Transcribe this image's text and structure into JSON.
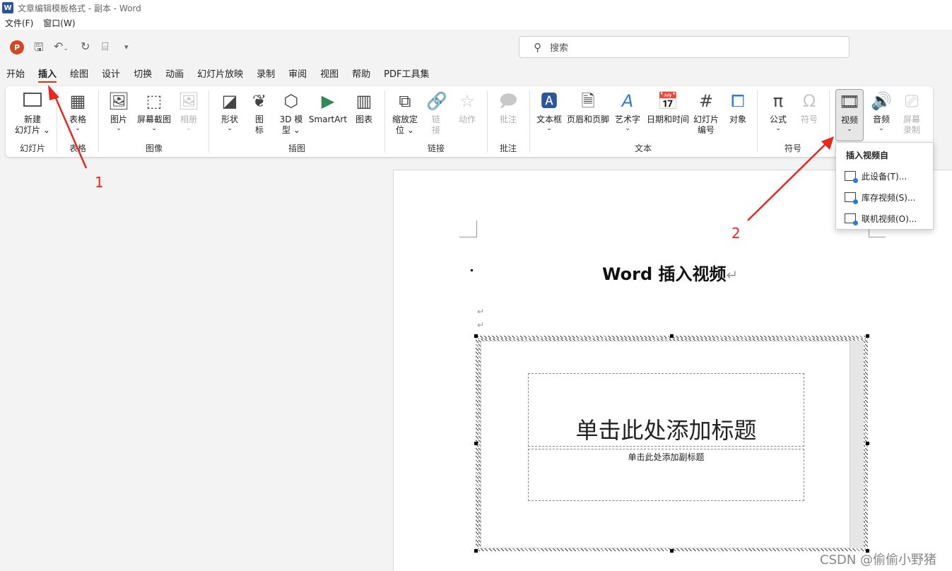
{
  "window": {
    "title": "文章编辑模板格式 - 副本 - Word",
    "logo": "W"
  },
  "menubar": [
    "文件(F)",
    "窗口(W)"
  ],
  "qat": {
    "app_badge": "P",
    "search_placeholder": "搜索"
  },
  "tabs": [
    "开始",
    "插入",
    "绘图",
    "设计",
    "切换",
    "动画",
    "幻灯片放映",
    "录制",
    "审阅",
    "视图",
    "帮助",
    "PDF工具集"
  ],
  "active_tab": "插入",
  "ribbon": {
    "groups": {
      "slides": "幻灯片",
      "tables": "表格",
      "images": "图像",
      "illustrations": "插图",
      "links": "链接",
      "comments": "批注",
      "text": "文本",
      "symbols": "符号"
    },
    "buttons": {
      "new_slide_1": "新建",
      "new_slide_2": "幻灯片",
      "table": "表格",
      "picture": "图片",
      "screenshot": "屏幕截图",
      "album": "相册",
      "shapes": "形状",
      "icons_1": "图",
      "icons_2": "标",
      "model3d_1": "3D 模",
      "model3d_2": "型",
      "smartart": "SmartArt",
      "chart": "图表",
      "zoom_1": "缩放定",
      "zoom_2": "位",
      "link_1": "链",
      "link_2": "接",
      "action": "动作",
      "comment": "批注",
      "textbox": "文本框",
      "header_footer": "页眉和页脚",
      "wordart": "艺术字",
      "datetime": "日期和时间",
      "slidenum_1": "幻灯片",
      "slidenum_2": "编号",
      "object": "对象",
      "equation": "公式",
      "symbol": "符号",
      "video": "视频",
      "audio": "音频",
      "screenrec_1": "屏幕",
      "screenrec_2": "录制"
    }
  },
  "dropdown": {
    "heading": "插入视频自",
    "items": [
      "此设备(T)...",
      "库存视频(S)...",
      "联机视频(O)..."
    ]
  },
  "document": {
    "title": "Word 插入视频",
    "return_mark": "↵",
    "slide_title_placeholder": "单击此处添加标题",
    "slide_subtitle_placeholder": "单击此处添加副标题"
  },
  "annotations": {
    "one": "1",
    "two": "2"
  },
  "watermark": "CSDN @偷偷小野猪",
  "colors": {
    "accent": "#c43e1c",
    "arrow": "#e8281c",
    "word_blue": "#2b579a"
  }
}
